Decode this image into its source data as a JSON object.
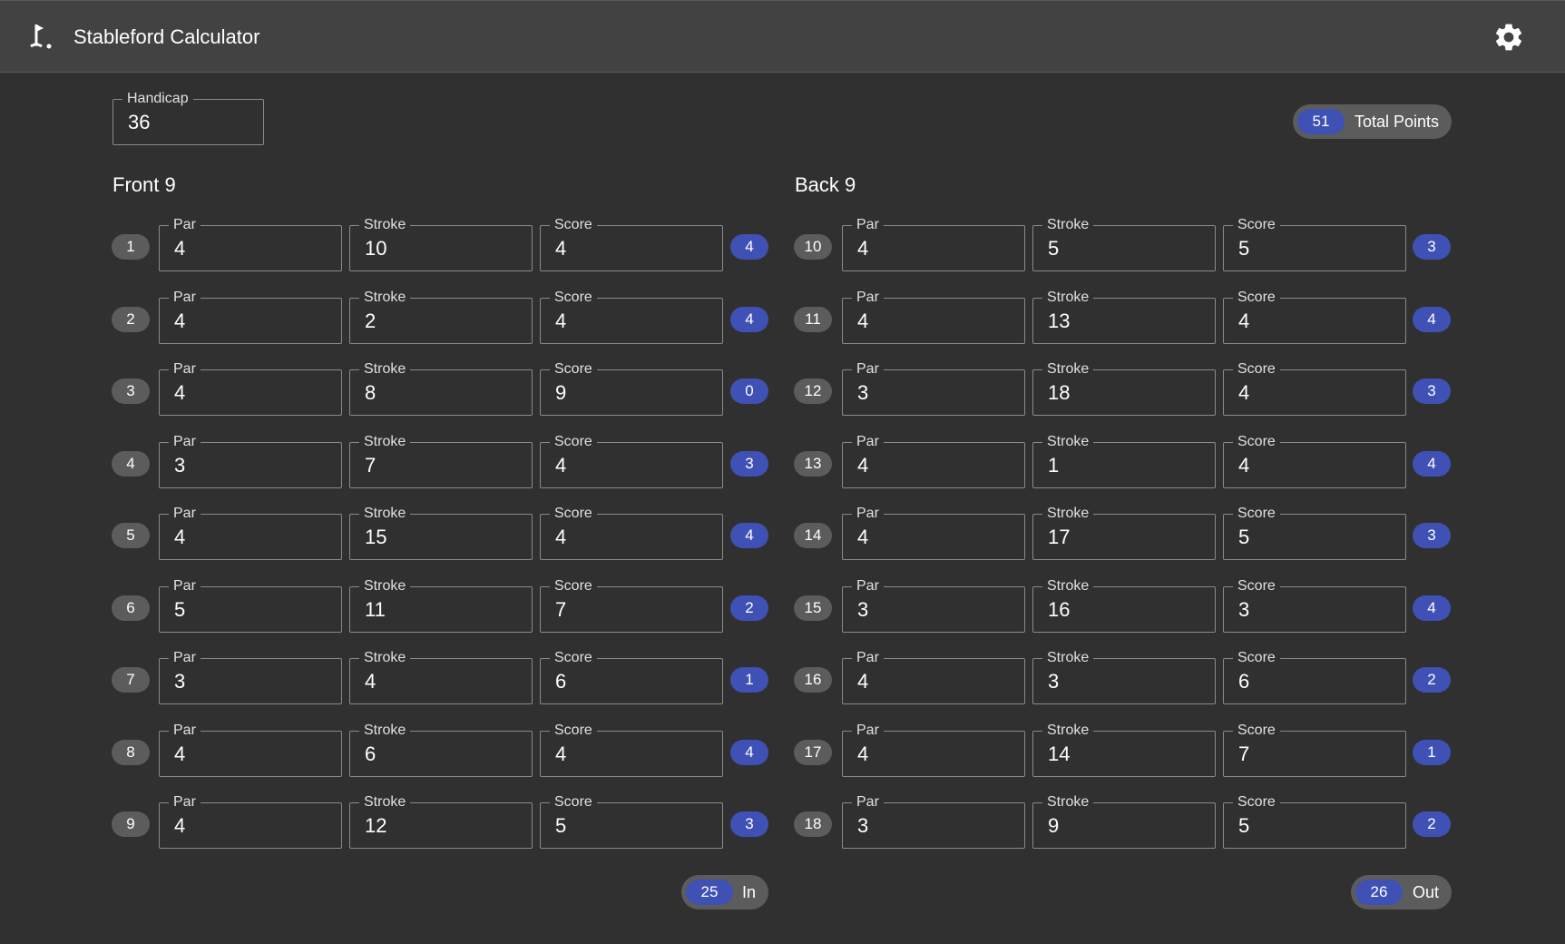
{
  "app": {
    "title": "Stableford Calculator",
    "logo_icon": "golf-flag-icon",
    "settings_icon": "gear-icon"
  },
  "handicap": {
    "label": "Handicap",
    "value": "36"
  },
  "total": {
    "value": "51",
    "label": "Total Points"
  },
  "labels": {
    "par": "Par",
    "stroke": "Stroke",
    "score": "Score"
  },
  "front": {
    "title": "Front 9",
    "holes": [
      {
        "hole": "1",
        "par": "4",
        "stroke": "10",
        "score": "4",
        "points": "4"
      },
      {
        "hole": "2",
        "par": "4",
        "stroke": "2",
        "score": "4",
        "points": "4"
      },
      {
        "hole": "3",
        "par": "4",
        "stroke": "8",
        "score": "9",
        "points": "0"
      },
      {
        "hole": "4",
        "par": "3",
        "stroke": "7",
        "score": "4",
        "points": "3"
      },
      {
        "hole": "5",
        "par": "4",
        "stroke": "15",
        "score": "4",
        "points": "4"
      },
      {
        "hole": "6",
        "par": "5",
        "stroke": "11",
        "score": "7",
        "points": "2"
      },
      {
        "hole": "7",
        "par": "3",
        "stroke": "4",
        "score": "6",
        "points": "1"
      },
      {
        "hole": "8",
        "par": "4",
        "stroke": "6",
        "score": "4",
        "points": "4"
      },
      {
        "hole": "9",
        "par": "4",
        "stroke": "12",
        "score": "5",
        "points": "3"
      }
    ],
    "total": {
      "value": "25",
      "label": "In"
    }
  },
  "back": {
    "title": "Back 9",
    "holes": [
      {
        "hole": "10",
        "par": "4",
        "stroke": "5",
        "score": "5",
        "points": "3"
      },
      {
        "hole": "11",
        "par": "4",
        "stroke": "13",
        "score": "4",
        "points": "4"
      },
      {
        "hole": "12",
        "par": "3",
        "stroke": "18",
        "score": "4",
        "points": "3"
      },
      {
        "hole": "13",
        "par": "4",
        "stroke": "1",
        "score": "4",
        "points": "4"
      },
      {
        "hole": "14",
        "par": "4",
        "stroke": "17",
        "score": "5",
        "points": "3"
      },
      {
        "hole": "15",
        "par": "3",
        "stroke": "16",
        "score": "3",
        "points": "4"
      },
      {
        "hole": "16",
        "par": "4",
        "stroke": "3",
        "score": "6",
        "points": "2"
      },
      {
        "hole": "17",
        "par": "4",
        "stroke": "14",
        "score": "7",
        "points": "1"
      },
      {
        "hole": "18",
        "par": "3",
        "stroke": "9",
        "score": "5",
        "points": "2"
      }
    ],
    "total": {
      "value": "26",
      "label": "Out"
    }
  },
  "colors": {
    "background": "#303030",
    "appbar": "#424242",
    "accent": "#3f51b5",
    "chip": "#5c5c5c"
  }
}
